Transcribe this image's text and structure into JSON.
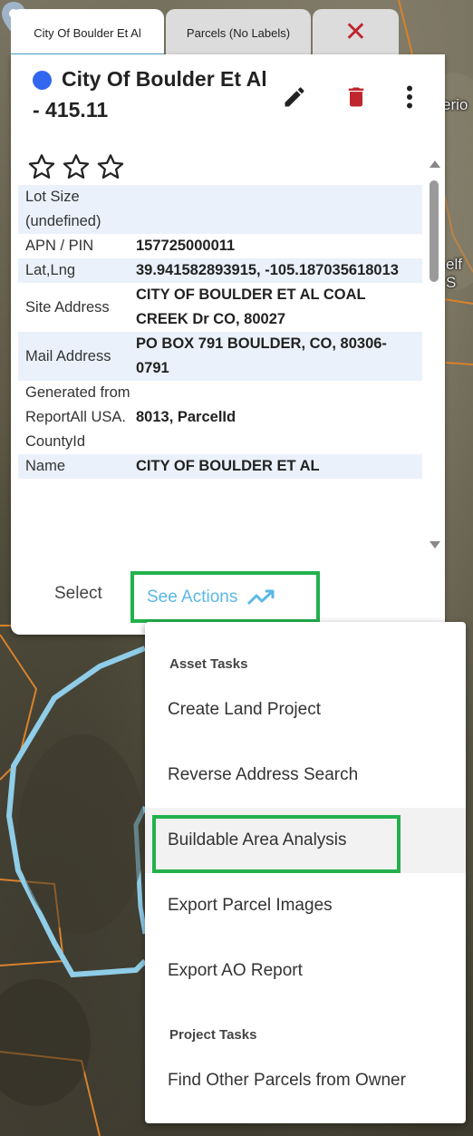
{
  "map": {
    "labels": [
      "erio",
      "elf S"
    ]
  },
  "tabs": [
    {
      "label": "City Of Boulder Et Al"
    },
    {
      "label": "Parcels (No Labels)"
    },
    {
      "label": "✕"
    }
  ],
  "panel": {
    "title": "City Of Boulder Et Al - 415.11",
    "dot_color": "#3366ee",
    "icons": {
      "edit": "pencil-icon",
      "delete": "trash-icon",
      "more": "more-vert-icon"
    },
    "rating": {
      "stars": 0,
      "max": 3
    },
    "rows": [
      {
        "key": "Lot Size (undefined)",
        "value": ""
      },
      {
        "key": "APN / PIN",
        "value": "157725000011"
      },
      {
        "key": "Lat,Lng",
        "value": "39.941582893915, -105.187035618013"
      },
      {
        "key": "Site Address",
        "value": "CITY OF BOULDER ET AL COAL CREEK Dr CO, 80027"
      },
      {
        "key": "Mail Address",
        "value": "PO BOX 791 BOULDER, CO, 80306-0791"
      },
      {
        "key": "Generated from ReportAll USA. CountyId",
        "value": "8013, ParcelId"
      },
      {
        "key": "Name",
        "value": "CITY OF BOULDER ET AL"
      }
    ],
    "footer": {
      "select_label": "Select",
      "actions_label": "See Actions",
      "actions_icon": "trending-up-icon"
    }
  },
  "menu": {
    "asset_section": "Asset Tasks",
    "asset_items": [
      "Create Land Project",
      "Reverse Address Search",
      "Buildable Area Analysis",
      "Export Parcel Images",
      "Export AO Report"
    ],
    "project_section": "Project Tasks",
    "project_items": [
      "Find Other Parcels from Owner"
    ]
  },
  "colors": {
    "accent_blue": "#5bb8e6",
    "highlight_green": "#22b14c",
    "delete_red": "#c0262d",
    "row_shade": "#eaf1fb"
  }
}
